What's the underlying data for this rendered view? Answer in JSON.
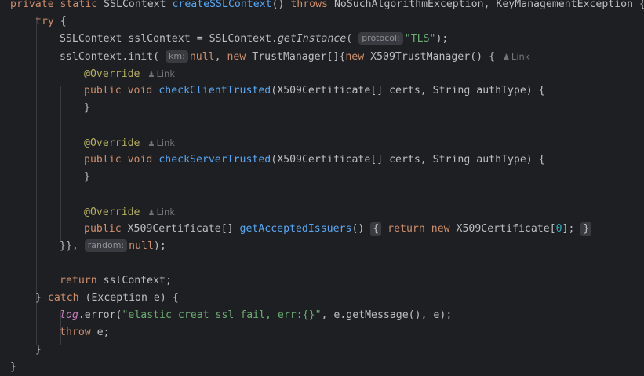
{
  "colors": {
    "background": "#1e1f22",
    "text": "#bcbec4",
    "keyword": "#cf8e6d",
    "function": "#56a8f5",
    "annotation": "#b3ae60",
    "string": "#6aab73",
    "number": "#2aacb8",
    "field": "#c77dbb",
    "inlay_bg": "#393b40",
    "inlay_text": "#8c8f95"
  },
  "inlay_hints": {
    "protocol": "protocol:",
    "km": "km:",
    "random": "random:"
  },
  "codelens": {
    "label": "Link",
    "icon": "person-icon"
  },
  "tokens": {
    "private": "private",
    "static": "static",
    "public": "public",
    "void": "void",
    "try": "try",
    "catch": "catch",
    "throws": "throws",
    "throw": "throw",
    "return": "return",
    "new": "new",
    "null": "null",
    "override": "@Override",
    "ssl_context": "SSLContext",
    "ssl_context_var": "sslContext",
    "create_ssl_context": "createSSLContext",
    "exceptions": "NoSuchAlgorithmException, KeyManagementException",
    "get_instance": "getInstance",
    "tls": "\"TLS\"",
    "init": "init",
    "trust_manager": "TrustManager",
    "x509_trust_manager": "X509TrustManager",
    "x509_certificate": "X509Certificate",
    "check_client_trusted": "checkClientTrusted",
    "check_server_trusted": "checkServerTrusted",
    "params": "X509Certificate[] certs, String authType",
    "get_accepted_issuers": "getAcceptedIssuers",
    "zero": "0",
    "exception_decl": "Exception e",
    "log": "log",
    "error": "error",
    "error_message": "\"elastic creat ssl fail, err:{}\"",
    "error_args": ", e.getMessage(), e",
    "e": "e"
  }
}
